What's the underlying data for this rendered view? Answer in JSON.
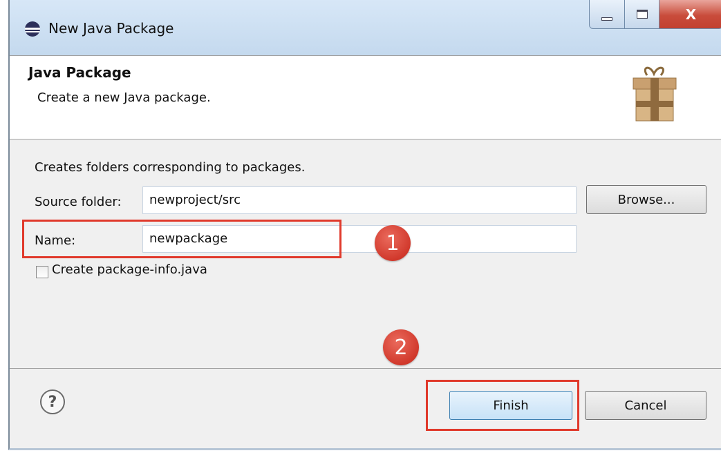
{
  "window": {
    "title": "New Java Package",
    "close_glyph": "X",
    "icon": "eclipse-icon"
  },
  "banner": {
    "title": "Java Package",
    "description": "Create a new Java package.",
    "icon": "package-icon"
  },
  "form": {
    "intro": "Creates folders corresponding to packages.",
    "source_folder_label": "Source folder:",
    "source_folder_value": "newproject/src",
    "browse_label": "Browse...",
    "name_label": "Name:",
    "name_value": "newpackage",
    "checkbox_label": "Create package-info.java",
    "checkbox_checked": false
  },
  "annotations": {
    "step1": "1",
    "step2": "2",
    "color": "#e0392b"
  },
  "footer": {
    "help_glyph": "?",
    "finish_label": "Finish",
    "cancel_label": "Cancel"
  }
}
